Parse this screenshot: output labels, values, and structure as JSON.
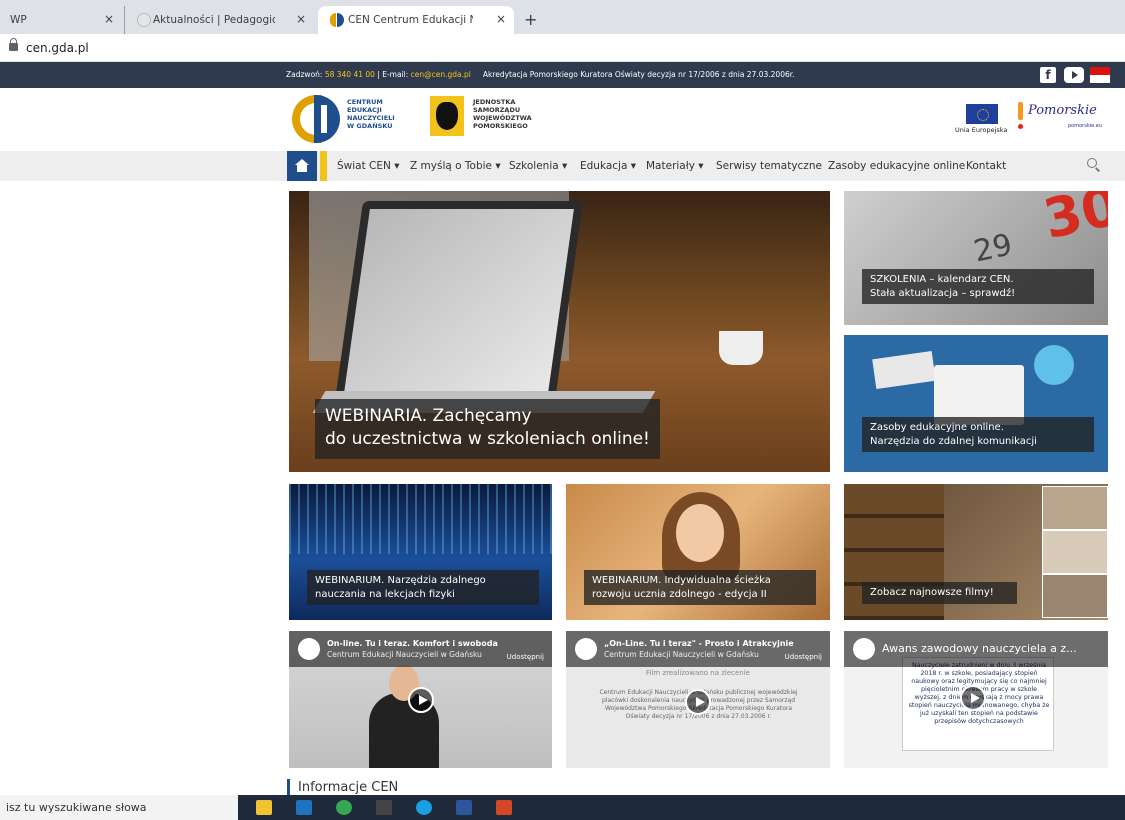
{
  "browser": {
    "tabs": [
      {
        "label": "WP",
        "close": "×"
      },
      {
        "label": "Aktualności | Pedagogiczna Biblio",
        "close": "×"
      },
      {
        "label": "CEN Centrum Edukacji Nauczyciel",
        "close": "×"
      }
    ],
    "new_tab": "+",
    "url": "cen.gda.pl"
  },
  "topbar": {
    "phone_label": "Zadzwoń: ",
    "phone": "58 340 41 00",
    "email_label": " | E-mail: ",
    "email": "cen@cen.gda.pl",
    "accreditation": "Akredytacja Pomorskiego Kuratora Oświaty decyzja nr 17/2006 z dnia 27.03.2006r.",
    "social": [
      "facebook-icon",
      "youtube-icon",
      "bip-icon"
    ]
  },
  "logos": {
    "cen_lines": [
      "CENTRUM",
      "EDUKACJI",
      "NAUCZYCIELI",
      "W GDAŃSKU"
    ],
    "jst_lines": [
      "JEDNOSTKA",
      "SAMORZĄDU",
      "WOJEWÓDZTWA",
      "POMORSKIEGO"
    ],
    "eu_label": "Unia Europejska",
    "pomorskie": "Pomorskie",
    "pomorskie_sub": "pomorskie.eu"
  },
  "nav": {
    "items": [
      "Świat CEN ▾",
      "Z myślą o Tobie ▾",
      "Szkolenia ▾",
      "Edukacja ▾",
      "Materiały ▾",
      "Serwisy tematyczne",
      "Zasoby edukacyjne online",
      "Kontakt"
    ]
  },
  "tiles": {
    "hero": [
      "WEBINARIA. Zachęcamy",
      "do uczestnictwa w szkoleniach online!"
    ],
    "szkolenia": [
      "SZKOLENIA – kalendarz CEN.",
      "Stała aktualizacja – sprawdź!"
    ],
    "szkolenia_num": "30",
    "szkolenia_num2": "29",
    "zasoby": [
      "Zasoby edukacyjne online.",
      "Narzędzia do zdalnej komunikacji"
    ],
    "fizyka": [
      "WEBINARIUM. Narzędzia zdalnego",
      "nauczania na lekcjach fizyki"
    ],
    "uczen": [
      "WEBINARIUM. Indywidualna ścieżka",
      "rozwoju ucznia zdolnego - edycja II"
    ],
    "filmy": "Zobacz najnowsze filmy!"
  },
  "videos": [
    {
      "title": "On-line. Tu i teraz. Komfort i swoboda",
      "channel": "Centrum Edukacji Nauczycieli w Gdańsku",
      "share": "Udostępnij"
    },
    {
      "title": "„On-Line. Tu i teraz\" - Prosto i Atrakcyjnie",
      "channel": "Centrum Edukacji Nauczycieli w Gdańsku",
      "note": "Film zrealizowano na zlecenie",
      "body": "Centrum Edukacji Nauczycieli w Gdańsku publicznej wojewódzkiej placówki doskonalenia nauczycieli prowadzonej przez Samorząd Województwa Pomorskiego Akredytacja Pomorskiego Kuratora Oświaty decyzja nr 17/2006 z dnia 27.03.2006 r.",
      "share": "Udostępnij"
    },
    {
      "title": "Awans zawodowy nauczyciela a z...",
      "panel_text": "Nauczyciele zatrudnieni w dniu 3 września 2018 r. w szkole, posiadający stopień naukowy oraz legitymujący się co najmniej pięcioletnim okresem pracy w szkole wyższej, z dniem uzyskają z mocy prawa stopień nauczyciela mianowanego, chyba że już uzyskali ten stopień na podstawie przepisów dotychczasowych"
    }
  ],
  "section_title": "Informacje CEN",
  "taskbar": {
    "search_placeholder": "isz tu wyszukiwane słowa"
  },
  "colors": {
    "brand_blue": "#1e4f8c",
    "brand_yellow": "#f3c31c",
    "topbar": "#2f3a4f"
  }
}
